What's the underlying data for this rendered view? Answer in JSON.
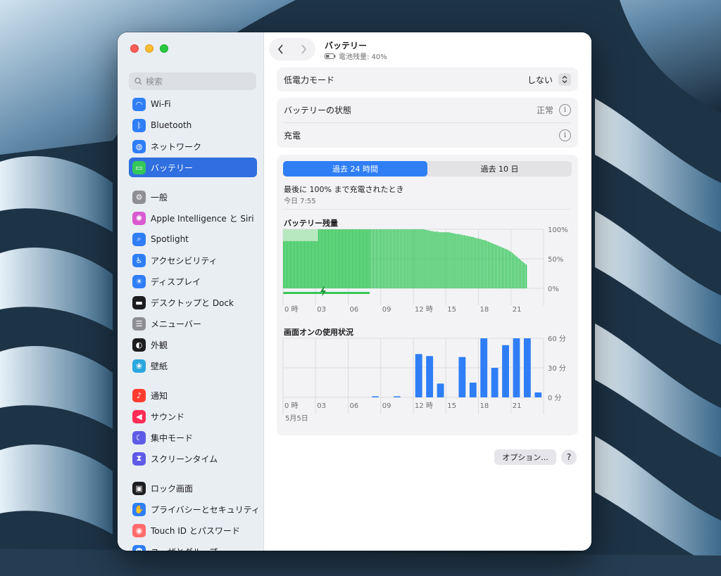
{
  "colors": {
    "accent": "#2f6fdf",
    "battery_bar": "#34c759",
    "battery_bar_charging": "#b8e8bf",
    "screen_bar": "#2f7ef6"
  },
  "sidebar": {
    "search_placeholder": "検索",
    "items": [
      {
        "label": "Wi-Fi",
        "icon": "wifi-icon",
        "color": "#2f7ef6"
      },
      {
        "label": "Bluetooth",
        "icon": "bluetooth-icon",
        "color": "#2f7ef6"
      },
      {
        "label": "ネットワーク",
        "icon": "globe-icon",
        "color": "#2f7ef6"
      },
      {
        "label": "バッテリー",
        "icon": "battery-icon",
        "color": "#34c759",
        "selected": true
      },
      {
        "label": "一般",
        "icon": "gear-icon",
        "color": "#8e8e93"
      },
      {
        "label": "Apple Intelligence と Siri",
        "icon": "siri-icon",
        "color": "#d95ad0"
      },
      {
        "label": "Spotlight",
        "icon": "magnifier-icon",
        "color": "#2f7ef6"
      },
      {
        "label": "アクセシビリティ",
        "icon": "accessibility-icon",
        "color": "#2f7ef6"
      },
      {
        "label": "ディスプレイ",
        "icon": "sun-icon",
        "color": "#2f7ef6"
      },
      {
        "label": "デスクトップと Dock",
        "icon": "dock-icon",
        "color": "#1d1d1f"
      },
      {
        "label": "メニューバー",
        "icon": "menubar-icon",
        "color": "#8e8e93"
      },
      {
        "label": "外観",
        "icon": "appearance-icon",
        "color": "#1d1d1f"
      },
      {
        "label": "壁紙",
        "icon": "wallpaper-icon",
        "color": "#2aa7dd"
      },
      {
        "label": "通知",
        "icon": "bell-icon",
        "color": "#ff3b30"
      },
      {
        "label": "サウンド",
        "icon": "speaker-icon",
        "color": "#ff2d55"
      },
      {
        "label": "集中モード",
        "icon": "moon-icon",
        "color": "#5e5ce6"
      },
      {
        "label": "スクリーンタイム",
        "icon": "hourglass-icon",
        "color": "#5e5ce6"
      },
      {
        "label": "ロック画面",
        "icon": "lock-icon",
        "color": "#1d1d1f"
      },
      {
        "label": "プライバシーとセキュリティ",
        "icon": "hand-icon",
        "color": "#2f7ef6"
      },
      {
        "label": "Touch ID とパスワード",
        "icon": "fingerprint-icon",
        "color": "#ff6b6b"
      },
      {
        "label": "ユーザとグループ",
        "icon": "users-icon",
        "color": "#2f7ef6"
      }
    ]
  },
  "header": {
    "title": "バッテリー",
    "subtitle": "電池残量: 40%"
  },
  "settings": {
    "low_power_label": "低電力モード",
    "low_power_value": "しない",
    "battery_health_label": "バッテリーの状態",
    "battery_health_value": "正常",
    "charging_label": "充電"
  },
  "usage": {
    "tabs": [
      "過去 24 時間",
      "過去 10 日"
    ],
    "last_charged_label": "最後に 100% まで充電されたとき",
    "last_charged_time": "今日 7:55",
    "date_label": "5月5日"
  },
  "chart_data": [
    {
      "type": "bar",
      "title": "バッテリー残量",
      "x_ticks": [
        "0 時",
        "03",
        "06",
        "09",
        "12 時",
        "15",
        "18",
        "21"
      ],
      "y_ticks": [
        "100%",
        "50%",
        "0%"
      ],
      "ylim": [
        0,
        100
      ],
      "charging_hours": [
        0,
        8
      ],
      "values": [
        80,
        80,
        80,
        80,
        80,
        80,
        80,
        80,
        80,
        80,
        80,
        80,
        80,
        80,
        80,
        80,
        80,
        80,
        80,
        80,
        80,
        80,
        80,
        80,
        80,
        100,
        100,
        100,
        100,
        100,
        100,
        100,
        100,
        100,
        100,
        100,
        100,
        100,
        100,
        100,
        100,
        100,
        100,
        100,
        100,
        100,
        100,
        100,
        100,
        100,
        100,
        100,
        100,
        100,
        100,
        100,
        100,
        100,
        100,
        100,
        100,
        100,
        100,
        100,
        100,
        100,
        100,
        100,
        100,
        100,
        100,
        100,
        100,
        100,
        100,
        100,
        100,
        100,
        100,
        100,
        100,
        100,
        100,
        100,
        100,
        100,
        100,
        100,
        100,
        100,
        100,
        100,
        100,
        100,
        100,
        100,
        100,
        100,
        100,
        100,
        100,
        99,
        99,
        98,
        98,
        97,
        97,
        96,
        96,
        96,
        96,
        95,
        95,
        95,
        95,
        95,
        95,
        95,
        95,
        94,
        94,
        93,
        93,
        92,
        92,
        92,
        91,
        91,
        90,
        90,
        89,
        89,
        88,
        88,
        87,
        87,
        86,
        85,
        85,
        84,
        84,
        83,
        82,
        82,
        81,
        80,
        79,
        78,
        77,
        76,
        75,
        74,
        73,
        72,
        71,
        70,
        69,
        68,
        67,
        66,
        65,
        63,
        62,
        60,
        58,
        56,
        54,
        52,
        50,
        48,
        46,
        44,
        42,
        40
      ]
    },
    {
      "type": "bar",
      "title": "画面オンの使用状況",
      "x_ticks": [
        "0 時",
        "03",
        "06",
        "09",
        "12 時",
        "15",
        "18",
        "21"
      ],
      "y_ticks": [
        "60 分",
        "30 分",
        "0 分"
      ],
      "ylim": [
        0,
        60
      ],
      "categories": [
        "0",
        "1",
        "2",
        "3",
        "4",
        "5",
        "6",
        "7",
        "8",
        "9",
        "10",
        "11",
        "12",
        "13",
        "14",
        "15",
        "16",
        "17",
        "18",
        "19",
        "20",
        "21",
        "22",
        "23"
      ],
      "values": [
        0,
        0,
        0,
        0,
        0,
        0,
        0,
        0,
        1,
        0,
        1,
        0,
        44,
        42,
        14,
        0,
        41,
        15,
        60,
        30,
        53,
        60,
        60,
        5
      ]
    }
  ],
  "footer": {
    "options_label": "オプション...",
    "help_label": "?"
  }
}
